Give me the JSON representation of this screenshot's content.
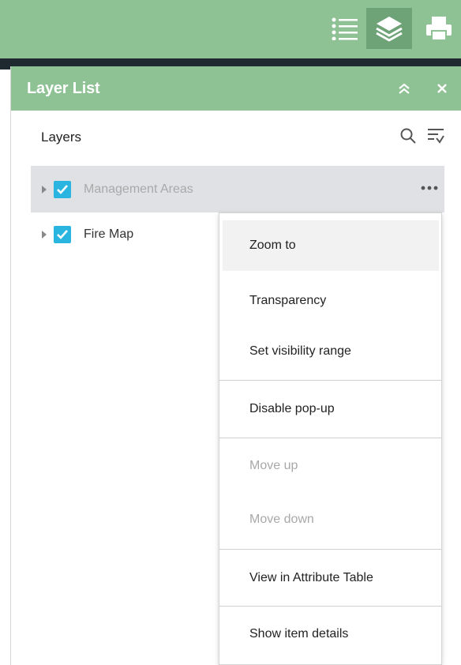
{
  "toolbar": {
    "buttons": [
      {
        "icon": "list-icon"
      },
      {
        "icon": "layers-icon"
      },
      {
        "icon": "print-icon"
      }
    ],
    "accent_color": "#8ec194"
  },
  "panel": {
    "title": "Layer List",
    "header_actions": [
      {
        "icon": "collapse-up-icon"
      },
      {
        "icon": "close-icon"
      }
    ],
    "subheader": {
      "title": "Layers",
      "actions": [
        {
          "icon": "search-icon"
        },
        {
          "icon": "filter-sort-icon"
        }
      ]
    },
    "layers": [
      {
        "label": "Management Areas",
        "checked": true,
        "selected": true
      },
      {
        "label": "Fire Map",
        "checked": true,
        "selected": false
      }
    ]
  },
  "context_menu": {
    "items": [
      {
        "label": "Zoom to",
        "state": "hover"
      },
      {
        "label": "Transparency",
        "state": "normal"
      },
      {
        "label": "Set visibility range",
        "state": "normal"
      },
      {
        "label": "Disable pop-up",
        "state": "normal"
      },
      {
        "label": "Move up",
        "state": "disabled"
      },
      {
        "label": "Move down",
        "state": "disabled"
      },
      {
        "label": "View in Attribute Table",
        "state": "normal"
      },
      {
        "label": "Show item details",
        "state": "normal"
      }
    ]
  },
  "colors": {
    "header_green": "#8ec194",
    "checkbox_blue": "#2ab4e0",
    "selected_row": "#dfe1e4"
  }
}
